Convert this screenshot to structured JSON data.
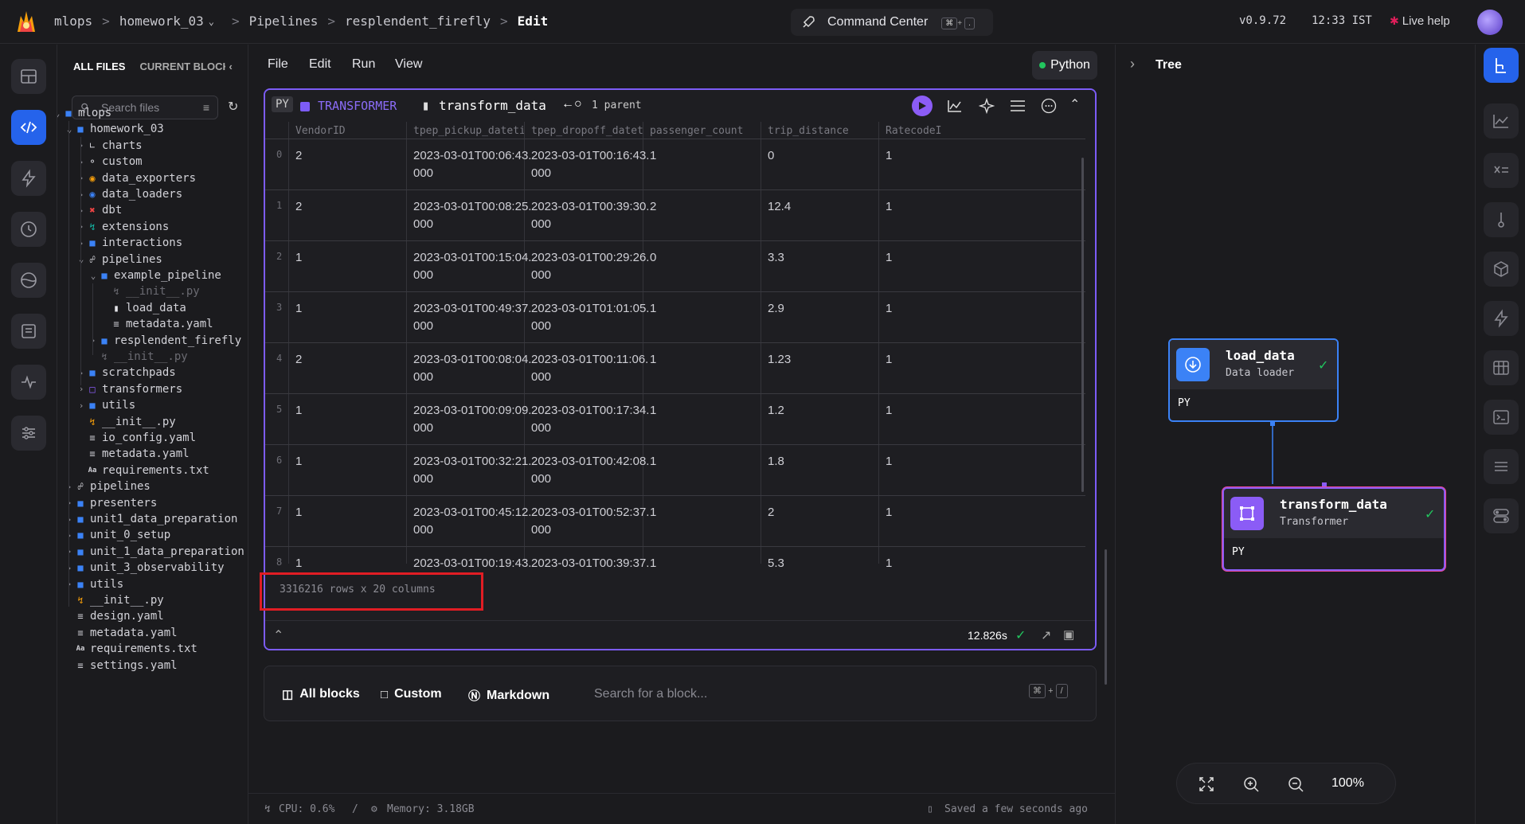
{
  "header": {
    "breadcrumbs": [
      "mlops",
      "homework_03",
      "Pipelines",
      "resplendent_firefly",
      "Edit"
    ],
    "command_center": "Command Center",
    "shortcut_keys": [
      "⌘",
      "+",
      "."
    ],
    "version": "v0.9.72",
    "time": "12:33 IST",
    "live_help": "Live help"
  },
  "file_panel": {
    "tab_all": "ALL FILES",
    "tab_current": "CURRENT BLOCK",
    "search_placeholder": "Search files",
    "tree": [
      {
        "label": "mlops",
        "icon": "folder-icon",
        "depth": 0,
        "chev": "v"
      },
      {
        "label": "homework_03",
        "icon": "folder-icon",
        "depth": 1,
        "chev": "v"
      },
      {
        "label": "charts",
        "icon": "chart-icon",
        "depth": 2,
        "chev": ">"
      },
      {
        "label": "custom",
        "icon": "custom-icon",
        "depth": 2,
        "chev": ">"
      },
      {
        "label": "data_exporters",
        "icon": "exporter-icon",
        "depth": 2,
        "chev": ">"
      },
      {
        "label": "data_loaders",
        "icon": "loader-icon",
        "depth": 2,
        "chev": ">"
      },
      {
        "label": "dbt",
        "icon": "dbt-icon",
        "depth": 2,
        "chev": ">"
      },
      {
        "label": "extensions",
        "icon": "extension-icon",
        "depth": 2,
        "chev": ">"
      },
      {
        "label": "interactions",
        "icon": "folder-icon",
        "depth": 2,
        "chev": ">"
      },
      {
        "label": "pipelines",
        "icon": "pipeline-icon",
        "depth": 2,
        "chev": "v"
      },
      {
        "label": "example_pipeline",
        "icon": "folder-icon",
        "depth": 3,
        "chev": "v"
      },
      {
        "label": "__init__.py",
        "icon": "python-icon",
        "depth": 4,
        "chev": "",
        "dim": true
      },
      {
        "label": "load_data",
        "icon": "file-icon",
        "depth": 4,
        "chev": ""
      },
      {
        "label": "metadata.yaml",
        "icon": "yaml-icon",
        "depth": 4,
        "chev": ""
      },
      {
        "label": "resplendent_firefly",
        "icon": "folder-icon",
        "depth": 3,
        "chev": ">"
      },
      {
        "label": "__init__.py",
        "icon": "python-icon",
        "depth": 3,
        "chev": "",
        "dim": true
      },
      {
        "label": "scratchpads",
        "icon": "folder-icon",
        "depth": 2,
        "chev": ">"
      },
      {
        "label": "transformers",
        "icon": "transformer-icon",
        "depth": 2,
        "chev": ">"
      },
      {
        "label": "utils",
        "icon": "folder-icon",
        "depth": 2,
        "chev": ">"
      },
      {
        "label": "__init__.py",
        "icon": "python-icon",
        "depth": 2,
        "chev": ""
      },
      {
        "label": "io_config.yaml",
        "icon": "yaml-icon",
        "depth": 2,
        "chev": ""
      },
      {
        "label": "metadata.yaml",
        "icon": "yaml-icon",
        "depth": 2,
        "chev": ""
      },
      {
        "label": "requirements.txt",
        "icon": "text-icon",
        "depth": 2,
        "chev": ""
      },
      {
        "label": "pipelines",
        "icon": "pipeline-icon",
        "depth": 1,
        "chev": ">"
      },
      {
        "label": "presenters",
        "icon": "folder-icon",
        "depth": 1,
        "chev": ">"
      },
      {
        "label": "unit1_data_preparation",
        "icon": "folder-icon",
        "depth": 1,
        "chev": ">"
      },
      {
        "label": "unit_0_setup",
        "icon": "folder-icon",
        "depth": 1,
        "chev": ">"
      },
      {
        "label": "unit_1_data_preparation",
        "icon": "folder-icon",
        "depth": 1,
        "chev": ">"
      },
      {
        "label": "unit_3_observability",
        "icon": "folder-icon",
        "depth": 1,
        "chev": ">"
      },
      {
        "label": "utils",
        "icon": "folder-icon",
        "depth": 1,
        "chev": ">"
      },
      {
        "label": "__init__.py",
        "icon": "python-icon",
        "depth": 1,
        "chev": ""
      },
      {
        "label": "design.yaml",
        "icon": "yaml-icon",
        "depth": 1,
        "chev": ""
      },
      {
        "label": "metadata.yaml",
        "icon": "yaml-icon",
        "depth": 1,
        "chev": ""
      },
      {
        "label": "requirements.txt",
        "icon": "text-icon",
        "depth": 1,
        "chev": ""
      },
      {
        "label": "settings.yaml",
        "icon": "yaml-icon",
        "depth": 1,
        "chev": ""
      }
    ]
  },
  "menubar": {
    "items": [
      "File",
      "Edit",
      "Run",
      "View"
    ],
    "kernel": "Python"
  },
  "block": {
    "lang": "PY",
    "type": "TRANSFORMER",
    "name": "transform_data",
    "parents": "1 parent",
    "columns": [
      "VendorID",
      "tpep_pickup_datetime",
      "tpep_dropoff_datetime",
      "passenger_count",
      "trip_distance",
      "RatecodeID"
    ],
    "rows": [
      {
        "idx": "0",
        "cells": [
          "2",
          "2023-03-01T00:06:43.\n000",
          "2023-03-01T00:16:43.\n000",
          "1",
          "0",
          "1"
        ]
      },
      {
        "idx": "1",
        "cells": [
          "2",
          "2023-03-01T00:08:25.\n000",
          "2023-03-01T00:39:30.\n000",
          "2",
          "12.4",
          "1"
        ]
      },
      {
        "idx": "2",
        "cells": [
          "1",
          "2023-03-01T00:15:04.\n000",
          "2023-03-01T00:29:26.\n000",
          "0",
          "3.3",
          "1"
        ]
      },
      {
        "idx": "3",
        "cells": [
          "1",
          "2023-03-01T00:49:37.\n000",
          "2023-03-01T01:01:05.\n000",
          "1",
          "2.9",
          "1"
        ]
      },
      {
        "idx": "4",
        "cells": [
          "2",
          "2023-03-01T00:08:04.\n000",
          "2023-03-01T00:11:06.\n000",
          "1",
          "1.23",
          "1"
        ]
      },
      {
        "idx": "5",
        "cells": [
          "1",
          "2023-03-01T00:09:09.\n000",
          "2023-03-01T00:17:34.\n000",
          "1",
          "1.2",
          "1"
        ]
      },
      {
        "idx": "6",
        "cells": [
          "1",
          "2023-03-01T00:32:21.\n000",
          "2023-03-01T00:42:08.\n000",
          "1",
          "1.8",
          "1"
        ]
      },
      {
        "idx": "7",
        "cells": [
          "1",
          "2023-03-01T00:45:12.\n000",
          "2023-03-01T00:52:37.\n000",
          "1",
          "2",
          "1"
        ]
      },
      {
        "idx": "8",
        "cells": [
          "1",
          "2023-03-01T00:19:43.",
          "2023-03-01T00:39:37.",
          "1",
          "5.3",
          "1"
        ]
      }
    ],
    "rows_info": "3316216 rows x 20 columns",
    "exec_time": "12.826s"
  },
  "add_bar": {
    "all_blocks": "All blocks",
    "custom": "Custom",
    "markdown": "Markdown",
    "search_placeholder": "Search for a block...",
    "shortcut": [
      "⌘",
      "+",
      "/"
    ]
  },
  "status": {
    "cpu": "CPU: 0.6%",
    "separator": "/",
    "memory": "Memory: 3.18GB",
    "saved": "Saved a few seconds ago"
  },
  "tree_panel": {
    "title": "Tree",
    "nodes": [
      {
        "name": "load_data",
        "type": "Data loader",
        "lang": "PY",
        "color": "#3b82f6"
      },
      {
        "name": "transform_data",
        "type": "Transformer",
        "lang": "PY",
        "color": "#8b5cf6"
      }
    ],
    "zoom": "100%"
  },
  "colors": {
    "accent_blue": "#2563eb",
    "transformer_purple": "#7c5cf6",
    "success_green": "#22c55e",
    "highlight_red": "#e11d24"
  }
}
